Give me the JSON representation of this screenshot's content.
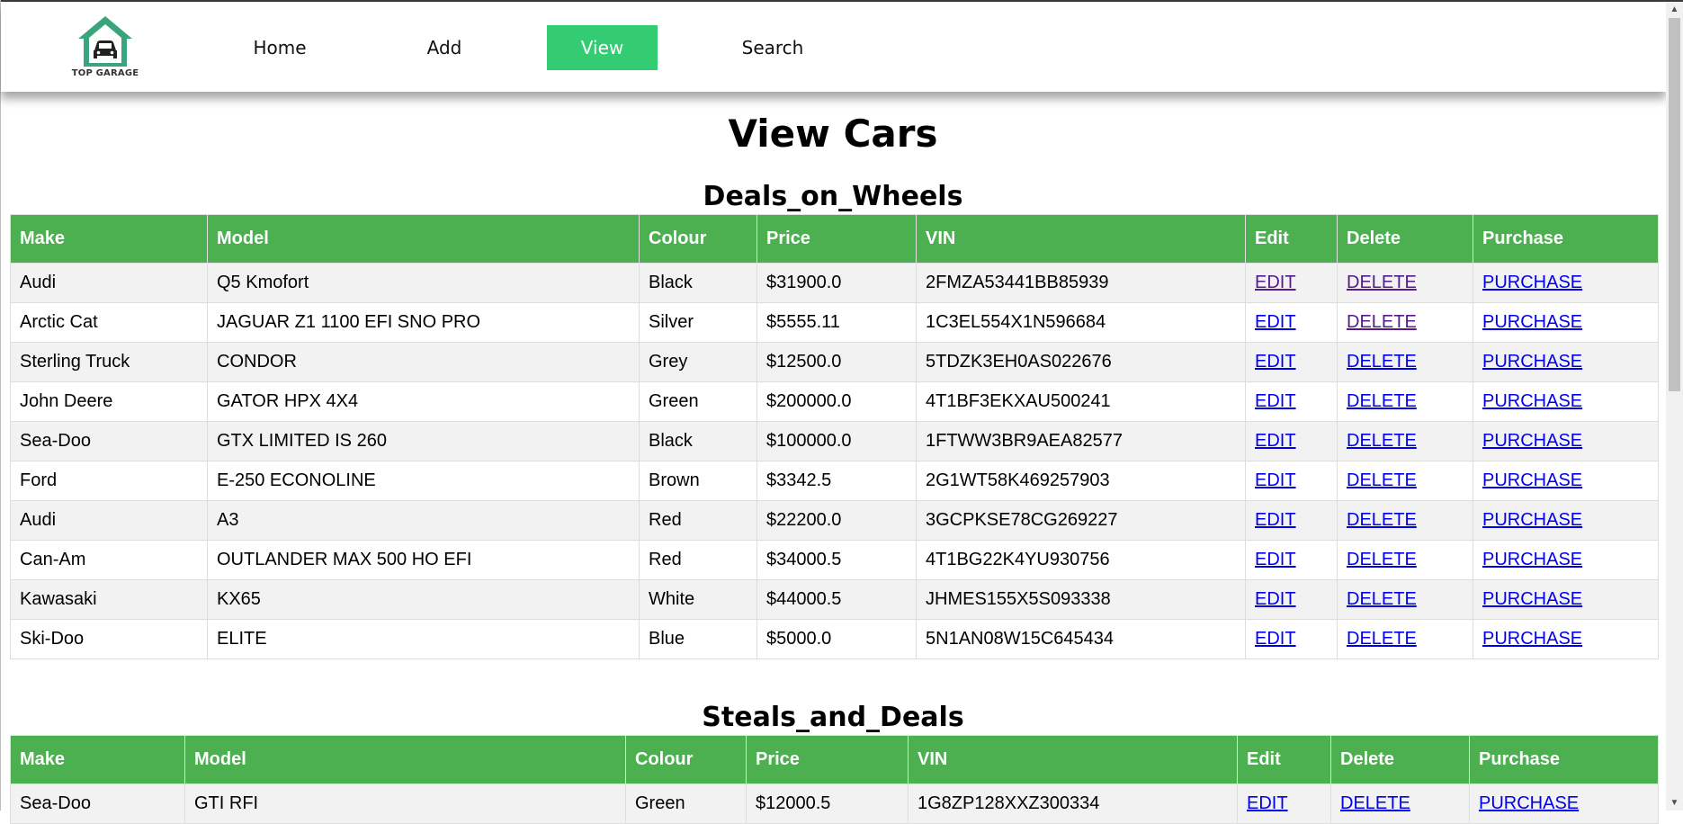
{
  "logo": {
    "text": "TOP GARAGE",
    "icon": "garage-car-icon",
    "color": "#3aa57c"
  },
  "nav": {
    "items": [
      {
        "label": "Home",
        "active": false
      },
      {
        "label": "Add",
        "active": false
      },
      {
        "label": "View",
        "active": true
      },
      {
        "label": "Search",
        "active": false
      }
    ],
    "active_color": "#34cc72"
  },
  "page_title": "View Cars",
  "columns": [
    "Make",
    "Model",
    "Colour",
    "Price",
    "VIN",
    "Edit",
    "Delete",
    "Purchase"
  ],
  "header_color": "#4caf50",
  "dealers": [
    {
      "name": "Deals_on_Wheels",
      "rows": [
        {
          "make": "Audi",
          "model": "Q5 Kmofort",
          "colour": "Black",
          "price": "$31900.0",
          "vin": "2FMZA53441BB85939",
          "edit": "EDIT",
          "delete": "DELETE",
          "purchase": "PURCHASE"
        },
        {
          "make": "Arctic Cat",
          "model": "JAGUAR Z1 1100 EFI SNO PRO",
          "colour": "Silver",
          "price": "$5555.11",
          "vin": "1C3EL554X1N596684",
          "edit": "EDIT",
          "delete": "DELETE",
          "purchase": "PURCHASE"
        },
        {
          "make": "Sterling Truck",
          "model": "CONDOR",
          "colour": "Grey",
          "price": "$12500.0",
          "vin": "5TDZK3EH0AS022676",
          "edit": "EDIT",
          "delete": "DELETE",
          "purchase": "PURCHASE"
        },
        {
          "make": "John Deere",
          "model": "GATOR HPX 4X4",
          "colour": "Green",
          "price": "$200000.0",
          "vin": "4T1BF3EKXAU500241",
          "edit": "EDIT",
          "delete": "DELETE",
          "purchase": "PURCHASE"
        },
        {
          "make": "Sea-Doo",
          "model": "GTX LIMITED IS 260",
          "colour": "Black",
          "price": "$100000.0",
          "vin": "1FTWW3BR9AEA82577",
          "edit": "EDIT",
          "delete": "DELETE",
          "purchase": "PURCHASE"
        },
        {
          "make": "Ford",
          "model": "E-250 ECONOLINE",
          "colour": "Brown",
          "price": "$3342.5",
          "vin": "2G1WT58K469257903",
          "edit": "EDIT",
          "delete": "DELETE",
          "purchase": "PURCHASE"
        },
        {
          "make": "Audi",
          "model": "A3",
          "colour": "Red",
          "price": "$22200.0",
          "vin": "3GCPKSE78CG269227",
          "edit": "EDIT",
          "delete": "DELETE",
          "purchase": "PURCHASE"
        },
        {
          "make": "Can-Am",
          "model": "OUTLANDER MAX 500 HO EFI",
          "colour": "Red",
          "price": "$34000.5",
          "vin": "4T1BG22K4YU930756",
          "edit": "EDIT",
          "delete": "DELETE",
          "purchase": "PURCHASE"
        },
        {
          "make": "Kawasaki",
          "model": "KX65",
          "colour": "White",
          "price": "$44000.5",
          "vin": "JHMES155X5S093338",
          "edit": "EDIT",
          "delete": "DELETE",
          "purchase": "PURCHASE"
        },
        {
          "make": "Ski-Doo",
          "model": "ELITE",
          "colour": "Blue",
          "price": "$5000.0",
          "vin": "5N1AN08W15C645434",
          "edit": "EDIT",
          "delete": "DELETE",
          "purchase": "PURCHASE"
        }
      ]
    },
    {
      "name": "Steals_and_Deals",
      "rows": [
        {
          "make": "Sea-Doo",
          "model": "GTI RFI",
          "colour": "Green",
          "price": "$12000.5",
          "vin": "1G8ZP128XXZ300334",
          "edit": "EDIT",
          "delete": "DELETE",
          "purchase": "PURCHASE"
        }
      ]
    }
  ]
}
